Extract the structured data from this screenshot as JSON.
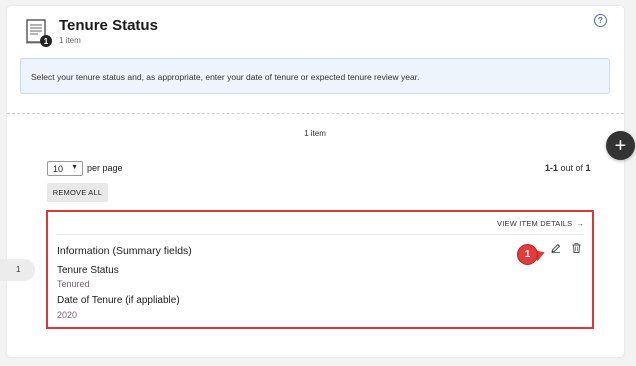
{
  "header": {
    "title": "Tenure Status",
    "subtitle": "1 item",
    "doc_badge": "1",
    "help_glyph": "?"
  },
  "info_box": {
    "text": "Select your tenure status and, as appropriate, enter your date of tenure or expected tenure review year."
  },
  "list": {
    "count_label": "1 item",
    "per_page_value": "10",
    "per_page_label": "per page",
    "range_text": "1-1",
    "out_of_text": " out of ",
    "total": "1",
    "remove_all_label": "REMOVE ALL",
    "add_glyph": "+"
  },
  "item": {
    "index": "1",
    "view_details_label": "VIEW ITEM DETAILS",
    "view_details_arrow": "→",
    "heading": "Information (Summary fields)",
    "fields": [
      {
        "label": "Tenure Status",
        "value": "Tenured"
      },
      {
        "label": "Date of Tenure (if appliable)",
        "value": "2020"
      }
    ],
    "callout_number": "1"
  },
  "icons": {
    "document": "document-icon",
    "help": "help-icon",
    "add": "plus-icon",
    "edit": "pencil-icon",
    "delete": "trash-icon",
    "dropdown": "chevron-down-icon",
    "arrow": "arrow-right-icon"
  },
  "colors": {
    "highlight_border": "#d9363e",
    "callout": "#e23b3b",
    "info_bg": "#eef4fb",
    "fab": "#333333"
  }
}
